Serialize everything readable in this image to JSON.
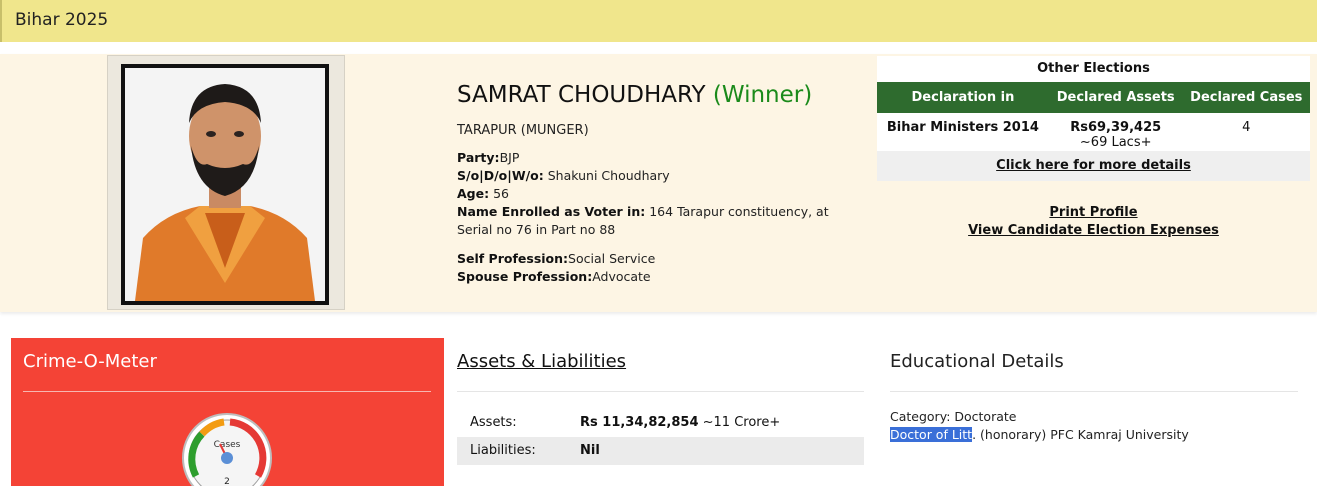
{
  "header": {
    "title": "Bihar 2025"
  },
  "candidate": {
    "name": "SAMRAT CHOUDHARY",
    "status": "(Winner)",
    "constituency": "TARAPUR (MUNGER)",
    "party_label": "Party:",
    "party": "BJP",
    "relation_label": "S/o|D/o|W/o:",
    "relation": "Shakuni Choudhary",
    "age_label": "Age:",
    "age": "56",
    "voter_label": "Name Enrolled as Voter in:",
    "voter": "164 Tarapur constituency, at Serial no 76 in Part no 88",
    "self_profession_label": "Self Profession:",
    "self_profession": "Social Service",
    "spouse_profession_label": "Spouse Profession:",
    "spouse_profession": "Advocate"
  },
  "other_elections": {
    "title": "Other Elections",
    "headers": [
      "Declaration in",
      "Declared Assets",
      "Declared Cases"
    ],
    "row": {
      "declaration": "Bihar Ministers 2014",
      "assets": "Rs69,39,425",
      "assets_approx": "~69 Lacs+",
      "cases": "4"
    },
    "more_link": "Click here for more details"
  },
  "links": {
    "print_profile": "Print Profile",
    "election_expenses": "View Candidate Election Expenses"
  },
  "crime": {
    "title": "Crime-O-Meter",
    "gauge_label": "Cases",
    "cases": "2",
    "colors": {
      "panel": "#f44336",
      "gauge_green": "#2e9e2e",
      "gauge_orange": "#f39c12",
      "gauge_red": "#e53935"
    }
  },
  "assets": {
    "title": "Assets & Liabilities",
    "assets_label": "Assets:",
    "assets_value": "Rs 11,34,82,854",
    "assets_approx": "~11 Crore+",
    "liabilities_label": "Liabilities:",
    "liabilities_value": "Nil"
  },
  "education": {
    "title": "Educational Details",
    "category": "Category: Doctorate",
    "degree_selected": "Doctor of Litt",
    "degree_rest": ". (honorary) PFC Kamraj University"
  }
}
